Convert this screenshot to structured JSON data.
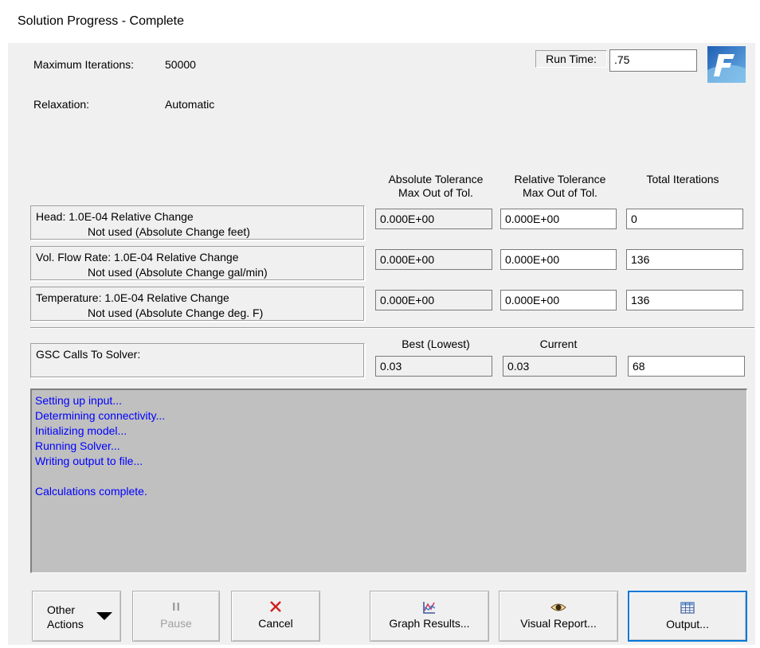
{
  "window": {
    "title": "Solution Progress - Complete"
  },
  "settings": {
    "max_iterations_label": "Maximum Iterations:",
    "max_iterations_value": "50000",
    "relaxation_label": "Relaxation:",
    "relaxation_value": "Automatic",
    "run_time_label": "Run Time:",
    "run_time_value": ".75"
  },
  "columns": {
    "abs_tol_line1": "Absolute Tolerance",
    "abs_tol_line2": "Max Out of Tol.",
    "rel_tol_line1": "Relative Tolerance",
    "rel_tol_line2": "Max Out of Tol.",
    "total_iter": "Total Iterations"
  },
  "rows": [
    {
      "line1": "Head: 1.0E-04 Relative Change",
      "line2": "Not used (Absolute Change feet)",
      "abs": "0.000E+00",
      "rel": "0.000E+00",
      "iter": "0"
    },
    {
      "line1": "Vol. Flow Rate: 1.0E-04 Relative Change",
      "line2": "Not used (Absolute Change gal/min)",
      "abs": "0.000E+00",
      "rel": "0.000E+00",
      "iter": "136"
    },
    {
      "line1": "Temperature: 1.0E-04 Relative Change",
      "line2": "Not used (Absolute Change deg. F)",
      "abs": "0.000E+00",
      "rel": "0.000E+00",
      "iter": "136"
    }
  ],
  "gsc": {
    "label": "GSC Calls To Solver:",
    "best_header": "Best (Lowest)",
    "current_header": "Current",
    "best_value": "0.03",
    "current_value": "0.03",
    "calls_value": "68"
  },
  "log": {
    "lines": [
      "Setting up input...",
      "Determining connectivity...",
      "Initializing model...",
      "Running Solver...",
      "Writing output to file...",
      "",
      "Calculations complete."
    ],
    "color": "#0000ff"
  },
  "buttons": {
    "other_line1": "Other",
    "other_line2": "Actions",
    "pause": "Pause",
    "cancel": "Cancel",
    "graph": "Graph Results...",
    "visual": "Visual Report...",
    "output": "Output..."
  },
  "icons": {
    "logo": "fathom-logo-icon",
    "pause": "pause-icon",
    "cancel": "cancel-x-icon",
    "graph": "graph-icon",
    "visual": "eye-icon",
    "output": "table-icon",
    "other": "dropdown-caret-icon"
  }
}
